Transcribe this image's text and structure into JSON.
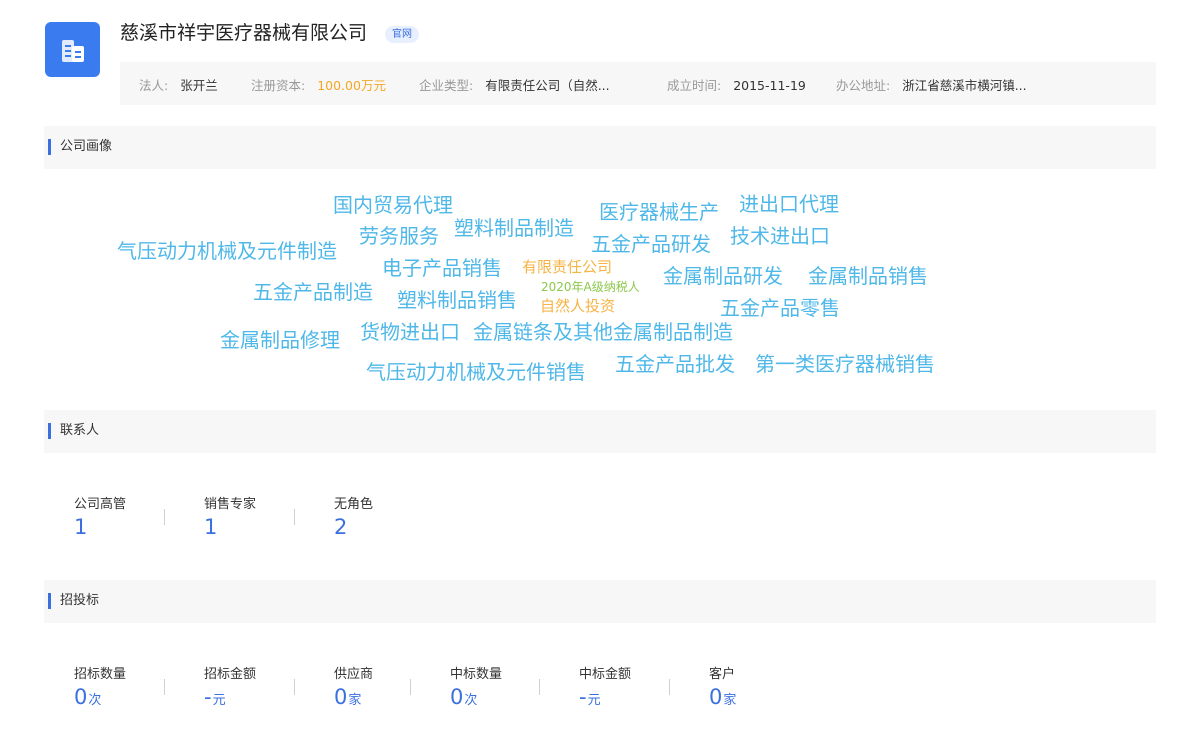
{
  "header": {
    "company_name": "慈溪市祥宇医疗器械有限公司",
    "official_tag": "官网",
    "info": [
      {
        "label": "法人:",
        "value": "张开兰"
      },
      {
        "label": "注册资本:",
        "value": "100.00万元"
      },
      {
        "label": "企业类型:",
        "value": "有限责任公司（自然..."
      },
      {
        "label": "成立时间:",
        "value": "2015-11-19"
      },
      {
        "label": "办公地址:",
        "value": "浙江省慈溪市横河镇..."
      }
    ]
  },
  "portrait": {
    "title": "公司画像",
    "words": [
      {
        "text": "国内贸易代理",
        "color": "#4fb8e8"
      },
      {
        "text": "医疗器械生产",
        "color": "#4fb8e8"
      },
      {
        "text": "进出口代理",
        "color": "#4fb8e8"
      },
      {
        "text": "劳务服务",
        "color": "#4fb8e8"
      },
      {
        "text": "塑料制品制造",
        "color": "#4fb8e8"
      },
      {
        "text": "五金产品研发",
        "color": "#4fb8e8"
      },
      {
        "text": "技术进出口",
        "color": "#4fb8e8"
      },
      {
        "text": "气压动力机械及元件制造",
        "color": "#4fb8e8"
      },
      {
        "text": "电子产品销售",
        "color": "#4fb8e8"
      },
      {
        "text": "有限责任公司",
        "color": "#f5b445"
      },
      {
        "text": "金属制品研发",
        "color": "#4fb8e8"
      },
      {
        "text": "金属制品销售",
        "color": "#4fb8e8"
      },
      {
        "text": "五金产品制造",
        "color": "#4fb8e8"
      },
      {
        "text": "2020年A级纳税人",
        "color": "#8cc84b"
      },
      {
        "text": "塑料制品销售",
        "color": "#4fb8e8"
      },
      {
        "text": "自然人投资",
        "color": "#f5b445"
      },
      {
        "text": "五金产品零售",
        "color": "#4fb8e8"
      },
      {
        "text": "货物进出口",
        "color": "#4fb8e8"
      },
      {
        "text": "金属链条及其他金属制品制造",
        "color": "#4fb8e8"
      },
      {
        "text": "金属制品修理",
        "color": "#4fb8e8"
      },
      {
        "text": "气压动力机械及元件销售",
        "color": "#4fb8e8"
      },
      {
        "text": "五金产品批发",
        "color": "#4fb8e8"
      },
      {
        "text": "第一类医疗器械销售",
        "color": "#4fb8e8"
      }
    ]
  },
  "contacts": {
    "title": "联系人",
    "stats": [
      {
        "label": "公司高管",
        "value": "1",
        "unit": ""
      },
      {
        "label": "销售专家",
        "value": "1",
        "unit": ""
      },
      {
        "label": "无角色",
        "value": "2",
        "unit": ""
      }
    ]
  },
  "bidding": {
    "title": "招投标",
    "stats": [
      {
        "label": "招标数量",
        "value": "0",
        "unit": "次"
      },
      {
        "label": "招标金额",
        "value": "-",
        "unit": "元"
      },
      {
        "label": "供应商",
        "value": "0",
        "unit": "家"
      },
      {
        "label": "中标数量",
        "value": "0",
        "unit": "次"
      },
      {
        "label": "中标金额",
        "value": "-",
        "unit": "元"
      },
      {
        "label": "客户",
        "value": "0",
        "unit": "家"
      }
    ]
  }
}
